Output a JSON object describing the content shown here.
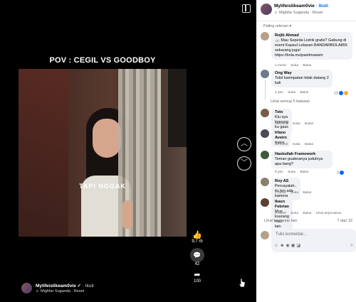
{
  "video": {
    "title": "POV : CEGIL VS GOODBOY",
    "overlay_text": "TAPI NGGAK"
  },
  "actions": {
    "like_count": "9,7 rb",
    "comment_count": "42",
    "share_count": "100"
  },
  "author": {
    "name": "MylifeisIikeam0vie",
    "verified_glyph": "✓",
    "follow_label": "· Ikuti",
    "music": "♬ Mighfar Suganda · Reset"
  },
  "panel": {
    "name": "MylifeisIikeam0vie",
    "follow_label": "· Ikuti",
    "music": "♬ Mighfar Suganda · Reset",
    "sort_label": "Paling relevan"
  },
  "comments": [
    {
      "name": "Rojib Ahmad",
      "text": "🚲 Mau Sepeda Listrik gratis? Gabung di event Kapsul Lebaran BANDARBOLA855 sekarang juga! https://bola.ms/pastimaswin",
      "time": "1 menit",
      "like": "Suka",
      "reply": "Balas"
    },
    {
      "name": "Ong Way",
      "text": "Tolol ksempatan tidak datang 2 kali",
      "time": "2 jam",
      "like": "Suka",
      "reply": "Balas",
      "reactions": "13"
    },
    {
      "name": "Toto",
      "text": "Klu sya lngsung ku gass😂",
      "time": "16 menit",
      "like": "Suka",
      "reply": "Balas"
    },
    {
      "name": "Irfano Aveiro",
      "text": "tepos",
      "time": "21 menit",
      "like": "Suka",
      "reply": "Balas"
    },
    {
      "name": "Hasbullah Framework",
      "text": "Teman guabnanya judulnya apa bang?",
      "time": "9 jam",
      "like": "Suka",
      "reply": "Balas",
      "reactions": "3"
    },
    {
      "name": "Roy AS",
      "text": "Percayalah.. itu krn ada kamera",
      "time": "1 menit",
      "like": "Suka",
      "reply": "Balas"
    },
    {
      "name": "Ikasn Febrian",
      "text": "Mun kuurang mah lain carita",
      "time": "9 menit",
      "like": "Suka",
      "reply": "Balas",
      "translate": "Lihat terjemahan"
    }
  ],
  "replies_link": "Lihat semua 5 balasan",
  "more_comments": "Lihat komentar lain",
  "count_label": "7 dari 32",
  "composer": {
    "placeholder": "Tulis komentar..."
  }
}
